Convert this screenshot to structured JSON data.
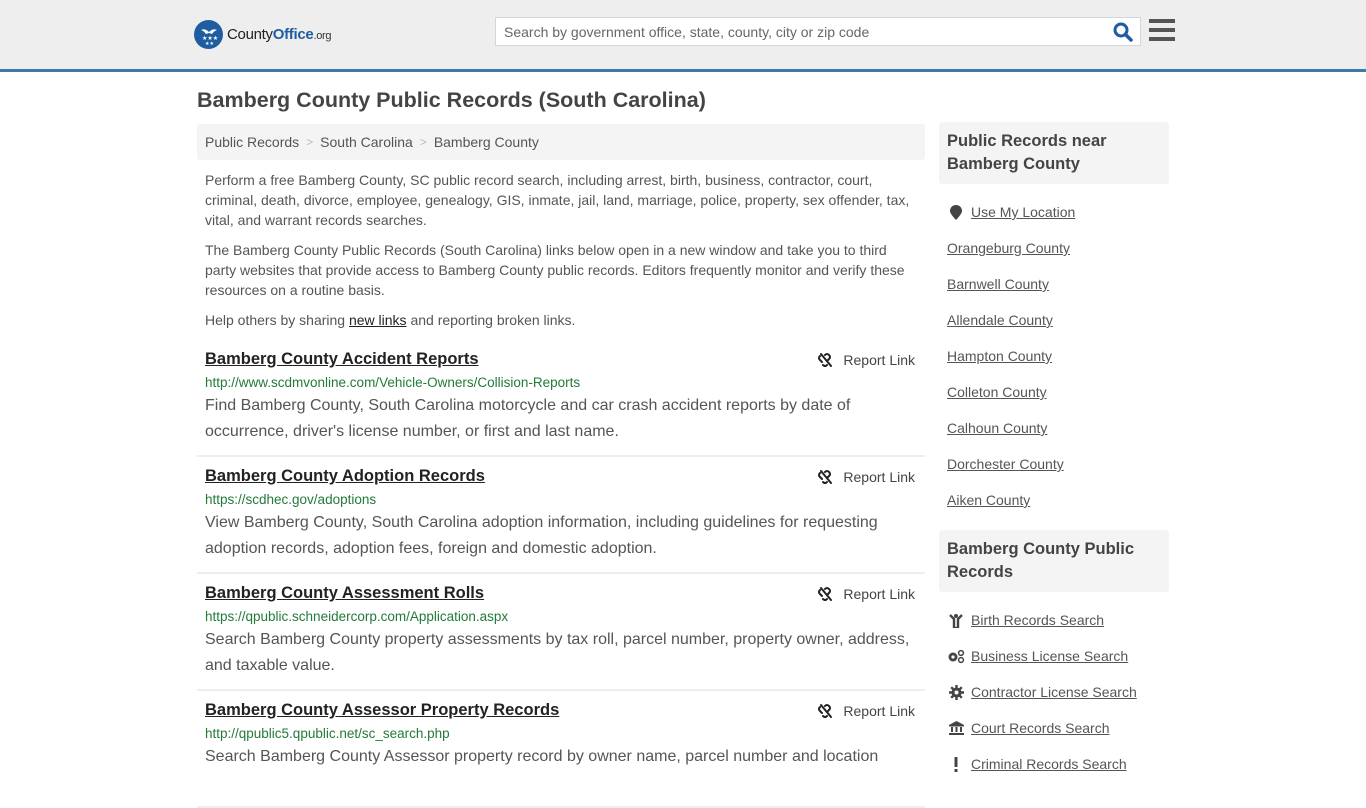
{
  "header": {
    "logo": {
      "name": "County",
      "name_bold": "Office",
      "tld": ".org"
    },
    "search": {
      "placeholder": "Search by government office, state, county, city or zip code",
      "value": ""
    },
    "accent_color": "#3a7bab",
    "brand_color": "#1f5da0"
  },
  "page": {
    "title": "Bamberg County Public Records (South Carolina)",
    "breadcrumb": [
      "Public Records",
      "South Carolina",
      "Bamberg County"
    ],
    "intro": {
      "p1": "Perform a free Bamberg County, SC public record search, including arrest, birth, business, contractor, court, criminal, death, divorce, employee, genealogy, GIS, inmate, jail, land, marriage, police, property, sex offender, tax, vital, and warrant records searches.",
      "p2": "The Bamberg County Public Records (South Carolina) links below open in a new window and take you to third party websites that provide access to Bamberg County public records. Editors frequently monitor and verify these resources on a routine basis.",
      "p3_before": "Help others by sharing ",
      "p3_link": "new links",
      "p3_after": " and reporting broken links."
    }
  },
  "records": [
    {
      "title": "Bamberg County Accident Reports",
      "url": "http://www.scdmvonline.com/Vehicle-Owners/Collision-Reports",
      "description": "Find Bamberg County, South Carolina motorcycle and car crash accident reports by date of occurrence, driver's license number, or first and last name.",
      "report_label": "Report Link"
    },
    {
      "title": "Bamberg County Adoption Records",
      "url": "https://scdhec.gov/adoptions",
      "description": "View Bamberg County, South Carolina adoption information, including guidelines for requesting adoption records, adoption fees, foreign and domestic adoption.",
      "report_label": "Report Link"
    },
    {
      "title": "Bamberg County Assessment Rolls",
      "url": "https://qpublic.schneidercorp.com/Application.aspx",
      "description": "Search Bamberg County property assessments by tax roll, parcel number, property owner, address, and taxable value.",
      "report_label": "Report Link"
    },
    {
      "title": "Bamberg County Assessor Property Records",
      "url": "http://qpublic5.qpublic.net/sc_search.php",
      "description": "Search Bamberg County Assessor property record by owner name, parcel number and location",
      "report_label": "Report Link"
    }
  ],
  "sidebar": {
    "nearby": {
      "heading": "Public Records near Bamberg County",
      "use_location": "Use My Location",
      "counties": [
        "Orangeburg County",
        "Barnwell County",
        "Allendale County",
        "Hampton County",
        "Colleton County",
        "Calhoun County",
        "Dorchester County",
        "Aiken County"
      ]
    },
    "county_records": {
      "heading": "Bamberg County Public Records",
      "items": [
        {
          "label": "Birth Records Search",
          "icon": "child-icon"
        },
        {
          "label": "Business License Search",
          "icon": "gears-icon"
        },
        {
          "label": "Contractor License Search",
          "icon": "gear-icon"
        },
        {
          "label": "Court Records Search",
          "icon": "courthouse-icon"
        },
        {
          "label": "Criminal Records Search",
          "icon": "exclamation-icon"
        }
      ]
    }
  }
}
